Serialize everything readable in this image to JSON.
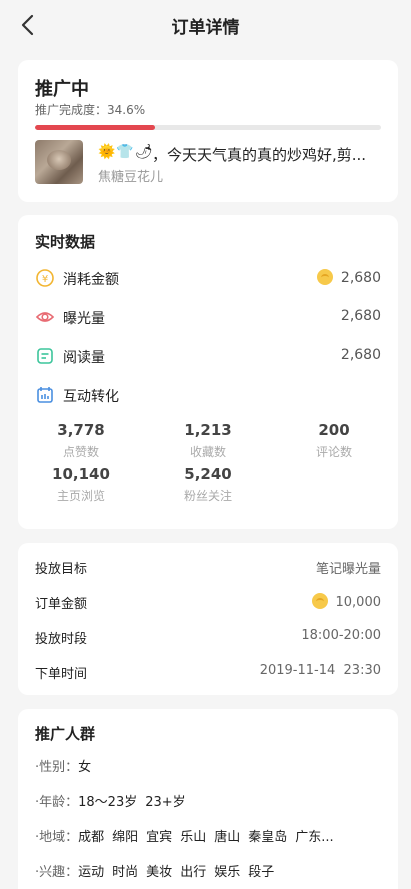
{
  "nav": {
    "title": "订单详情"
  },
  "status": {
    "title": "推广中",
    "progress_label": "推广完成度：34.6%",
    "progress": 0.346,
    "note": {
      "emojis": "🌞👕🌶",
      "title": "，今天天气真的真的炒鸡好,剪...",
      "author": "焦糖豆花儿"
    }
  },
  "realtime": {
    "title": "实时数据",
    "consumed": {
      "label": "消耗金额",
      "value": "2,680",
      "icon": "coin-circle-icon"
    },
    "exposure": {
      "label": "曝光量",
      "value": "2,680",
      "icon": "eye-icon"
    },
    "reads": {
      "label": "阅读量",
      "value": "2,680",
      "icon": "document-icon"
    },
    "interaction": {
      "label": "互动转化",
      "icon": "chart-icon",
      "stats": [
        {
          "num": "3,778",
          "label": "点赞数"
        },
        {
          "num": "1,213",
          "label": "收藏数"
        },
        {
          "num": "200",
          "label": "评论数"
        },
        {
          "num": "10,140",
          "label": "主页浏览"
        },
        {
          "num": "5,240",
          "label": "粉丝关注"
        }
      ]
    }
  },
  "order": {
    "target": {
      "label": "投放目标",
      "value": "笔记曝光量"
    },
    "amount": {
      "label": "订单金额",
      "value": "10,000"
    },
    "period": {
      "label": "投放时段",
      "value": "18:00-20:00"
    },
    "time": {
      "label": "下单时间",
      "value": "2019-11-14  23:30"
    }
  },
  "audience": {
    "title": "推广人群",
    "gender": {
      "label": "·性别：",
      "values": [
        "女"
      ]
    },
    "age": {
      "label": "·年龄：",
      "values": [
        "18～23岁",
        "23+岁"
      ]
    },
    "region": {
      "label": "·地域：",
      "values": [
        "成都",
        "绵阳",
        "宜宾",
        "乐山",
        "唐山",
        "秦皇岛",
        "广东..."
      ]
    },
    "interest": {
      "label": "·兴趣：",
      "values": [
        "运动",
        "时尚",
        "美妆",
        "出行",
        "娱乐",
        "段子"
      ]
    }
  },
  "colors": {
    "accent": "#e3474f",
    "coin": "#f7c94a",
    "eye": "#e86b73",
    "doc": "#3cc59b",
    "chart": "#4a8fe0"
  }
}
